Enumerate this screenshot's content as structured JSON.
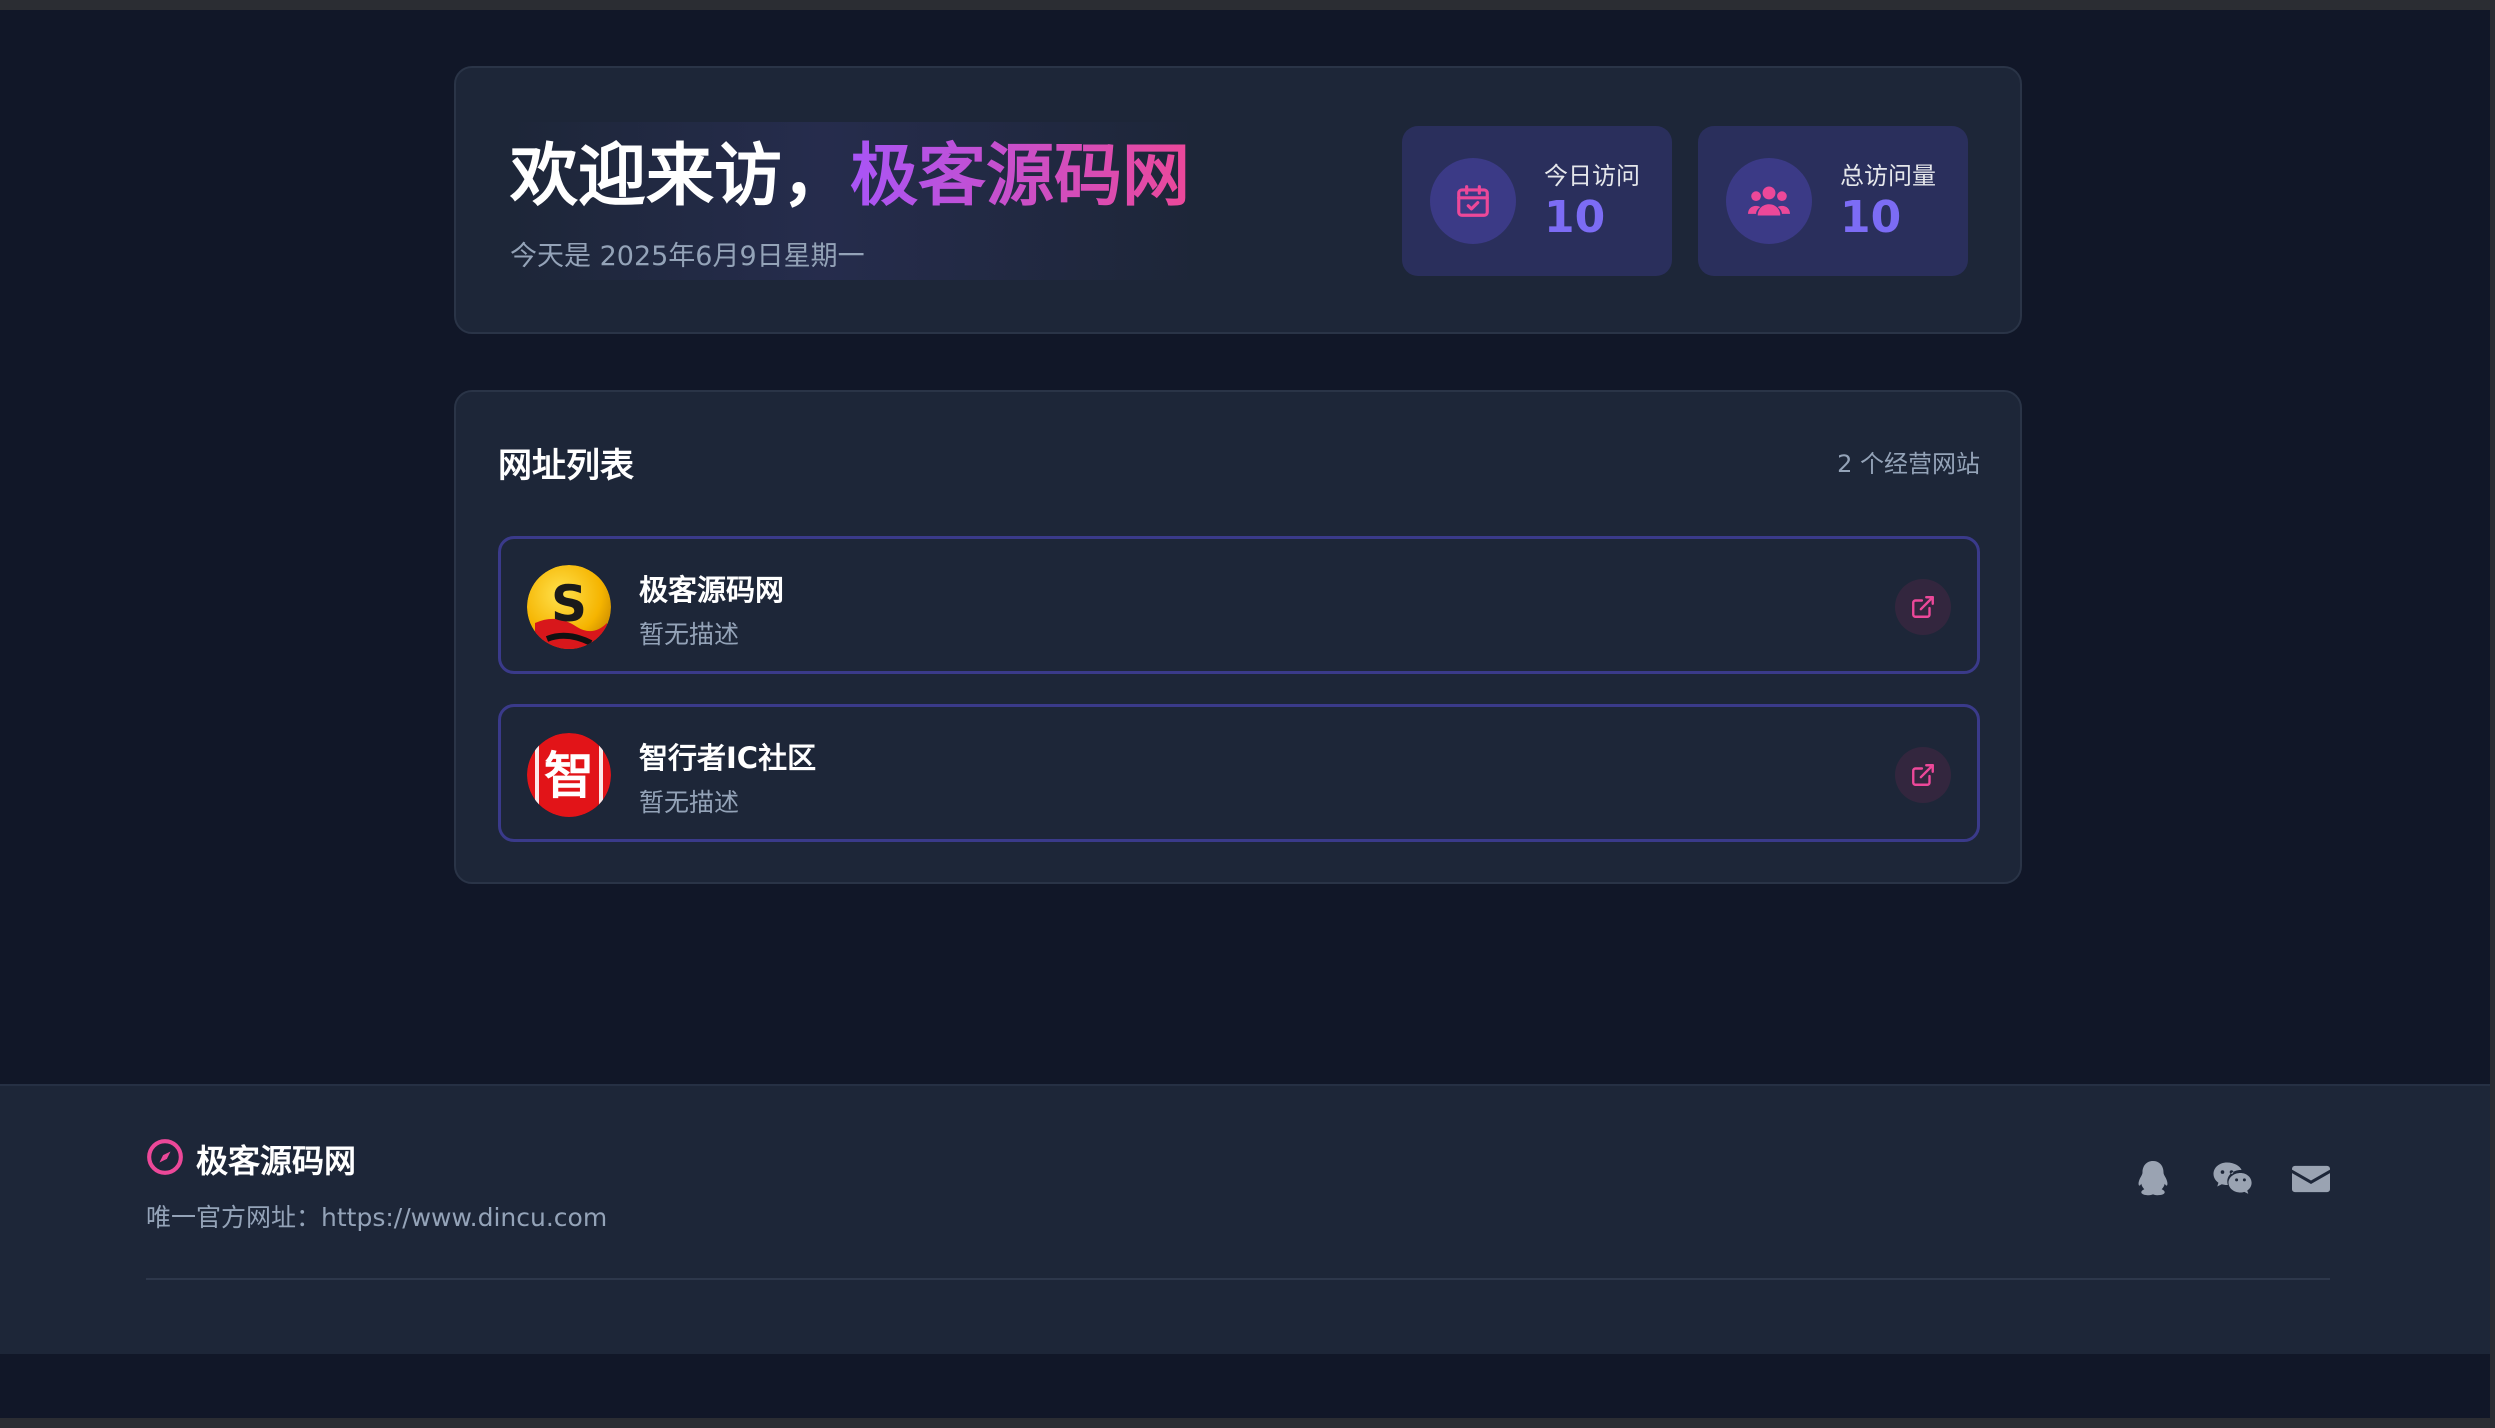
{
  "welcome": {
    "prefix": "欢迎来访，",
    "brand": "极客源码网",
    "date": "今天是 2025年6月9日星期一"
  },
  "stats": {
    "today": {
      "label": "今日访问",
      "value": "10",
      "icon": "calendar-check-icon"
    },
    "total": {
      "label": "总访问量",
      "value": "10",
      "icon": "users-icon"
    }
  },
  "site_list": {
    "title": "网址列表",
    "count": "2 个经营网站",
    "items": [
      {
        "name": "极客源码网",
        "desc": "暂无描述",
        "logo": "S"
      },
      {
        "name": "智行者IC社区",
        "desc": "暂无描述",
        "logo": "智"
      }
    ]
  },
  "footer": {
    "brand": "极客源码网",
    "url": "唯一官方网址：https://www.dincu.com",
    "social": [
      "qq-icon",
      "wechat-icon",
      "mail-icon"
    ]
  },
  "colors": {
    "background": "#111728",
    "card": "#1d2638",
    "accent_pink": "#ec4899",
    "accent_purple": "#7c6cf5",
    "item_border": "#3a3a8a"
  }
}
